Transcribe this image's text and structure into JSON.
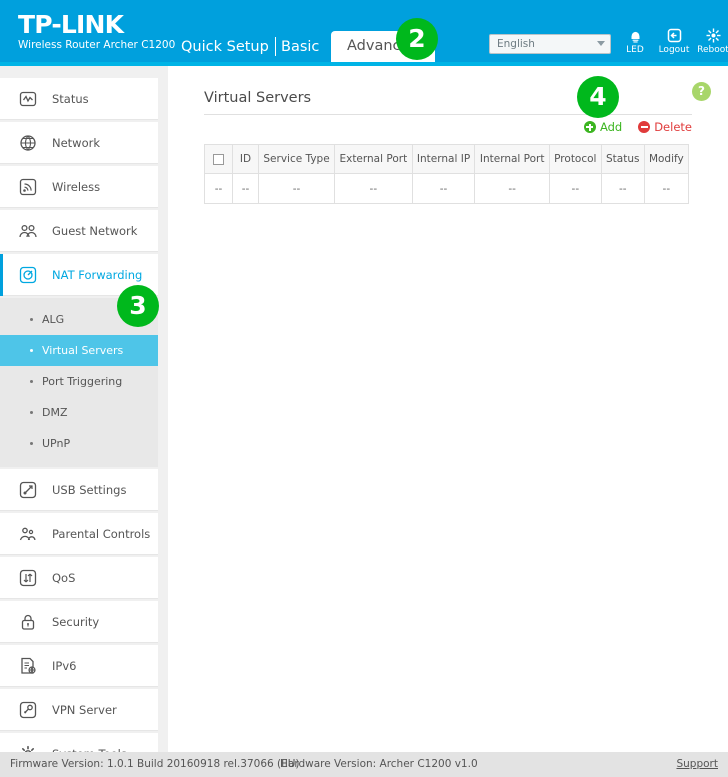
{
  "header": {
    "logo_main": "TP-LINK",
    "logo_sub": "Wireless Router Archer C1200",
    "tabs": [
      {
        "label": "Quick Setup",
        "active": false
      },
      {
        "label": "Basic",
        "active": false
      },
      {
        "label": "Advanced",
        "active": true
      }
    ],
    "language": {
      "value": "English",
      "placeholder": "English"
    },
    "icons": [
      {
        "name": "led-icon",
        "label": "LED"
      },
      {
        "name": "logout-icon",
        "label": "Logout"
      },
      {
        "name": "reboot-icon",
        "label": "Reboot"
      }
    ],
    "accent_color": "#00a0dd"
  },
  "sidebar": {
    "items": [
      {
        "label": "Status",
        "icon": "status-icon",
        "active": false
      },
      {
        "label": "Network",
        "icon": "globe-icon",
        "active": false
      },
      {
        "label": "Wireless",
        "icon": "wireless-icon",
        "active": false
      },
      {
        "label": "Guest Network",
        "icon": "guest-network-icon",
        "active": false
      },
      {
        "label": "NAT Forwarding",
        "icon": "nat-forwarding-icon",
        "active": true
      },
      {
        "label": "USB Settings",
        "icon": "usb-icon",
        "active": false
      },
      {
        "label": "Parental Controls",
        "icon": "parental-controls-icon",
        "active": false
      },
      {
        "label": "QoS",
        "icon": "qos-icon",
        "active": false
      },
      {
        "label": "Security",
        "icon": "lock-icon",
        "active": false
      },
      {
        "label": "IPv6",
        "icon": "ipv6-icon",
        "active": false
      },
      {
        "label": "VPN Server",
        "icon": "vpn-key-icon",
        "active": false
      },
      {
        "label": "System Tools",
        "icon": "gear-icon",
        "active": false
      }
    ],
    "submenu": [
      {
        "label": "ALG",
        "selected": false
      },
      {
        "label": "Virtual Servers",
        "selected": true
      },
      {
        "label": "Port Triggering",
        "selected": false
      },
      {
        "label": "DMZ",
        "selected": false
      },
      {
        "label": "UPnP",
        "selected": false
      }
    ],
    "selected_color": "#4ec5e8"
  },
  "main": {
    "title": "Virtual Servers",
    "help_label": "?",
    "add_label": "Add",
    "delete_label": "Delete",
    "add_color": "#3cb521",
    "delete_color": "#e03b3b",
    "table": {
      "headers": [
        "",
        "ID",
        "Service Type",
        "External Port",
        "Internal IP",
        "Internal Port",
        "Protocol",
        "Status",
        "Modify"
      ],
      "rows": [
        [
          "--",
          "--",
          "--",
          "--",
          "--",
          "--",
          "--",
          "--",
          "--"
        ]
      ]
    }
  },
  "footer": {
    "firmware": "Firmware Version: 1.0.1 Build 20160918 rel.37066 (EU)",
    "hardware": "Hardware Version: Archer C1200 v1.0",
    "support": "Support"
  },
  "annotations": [
    {
      "number": "2",
      "target": "advanced-tab"
    },
    {
      "number": "3",
      "target": "virtual-servers-submenu"
    },
    {
      "number": "4",
      "target": "add-button"
    }
  ]
}
